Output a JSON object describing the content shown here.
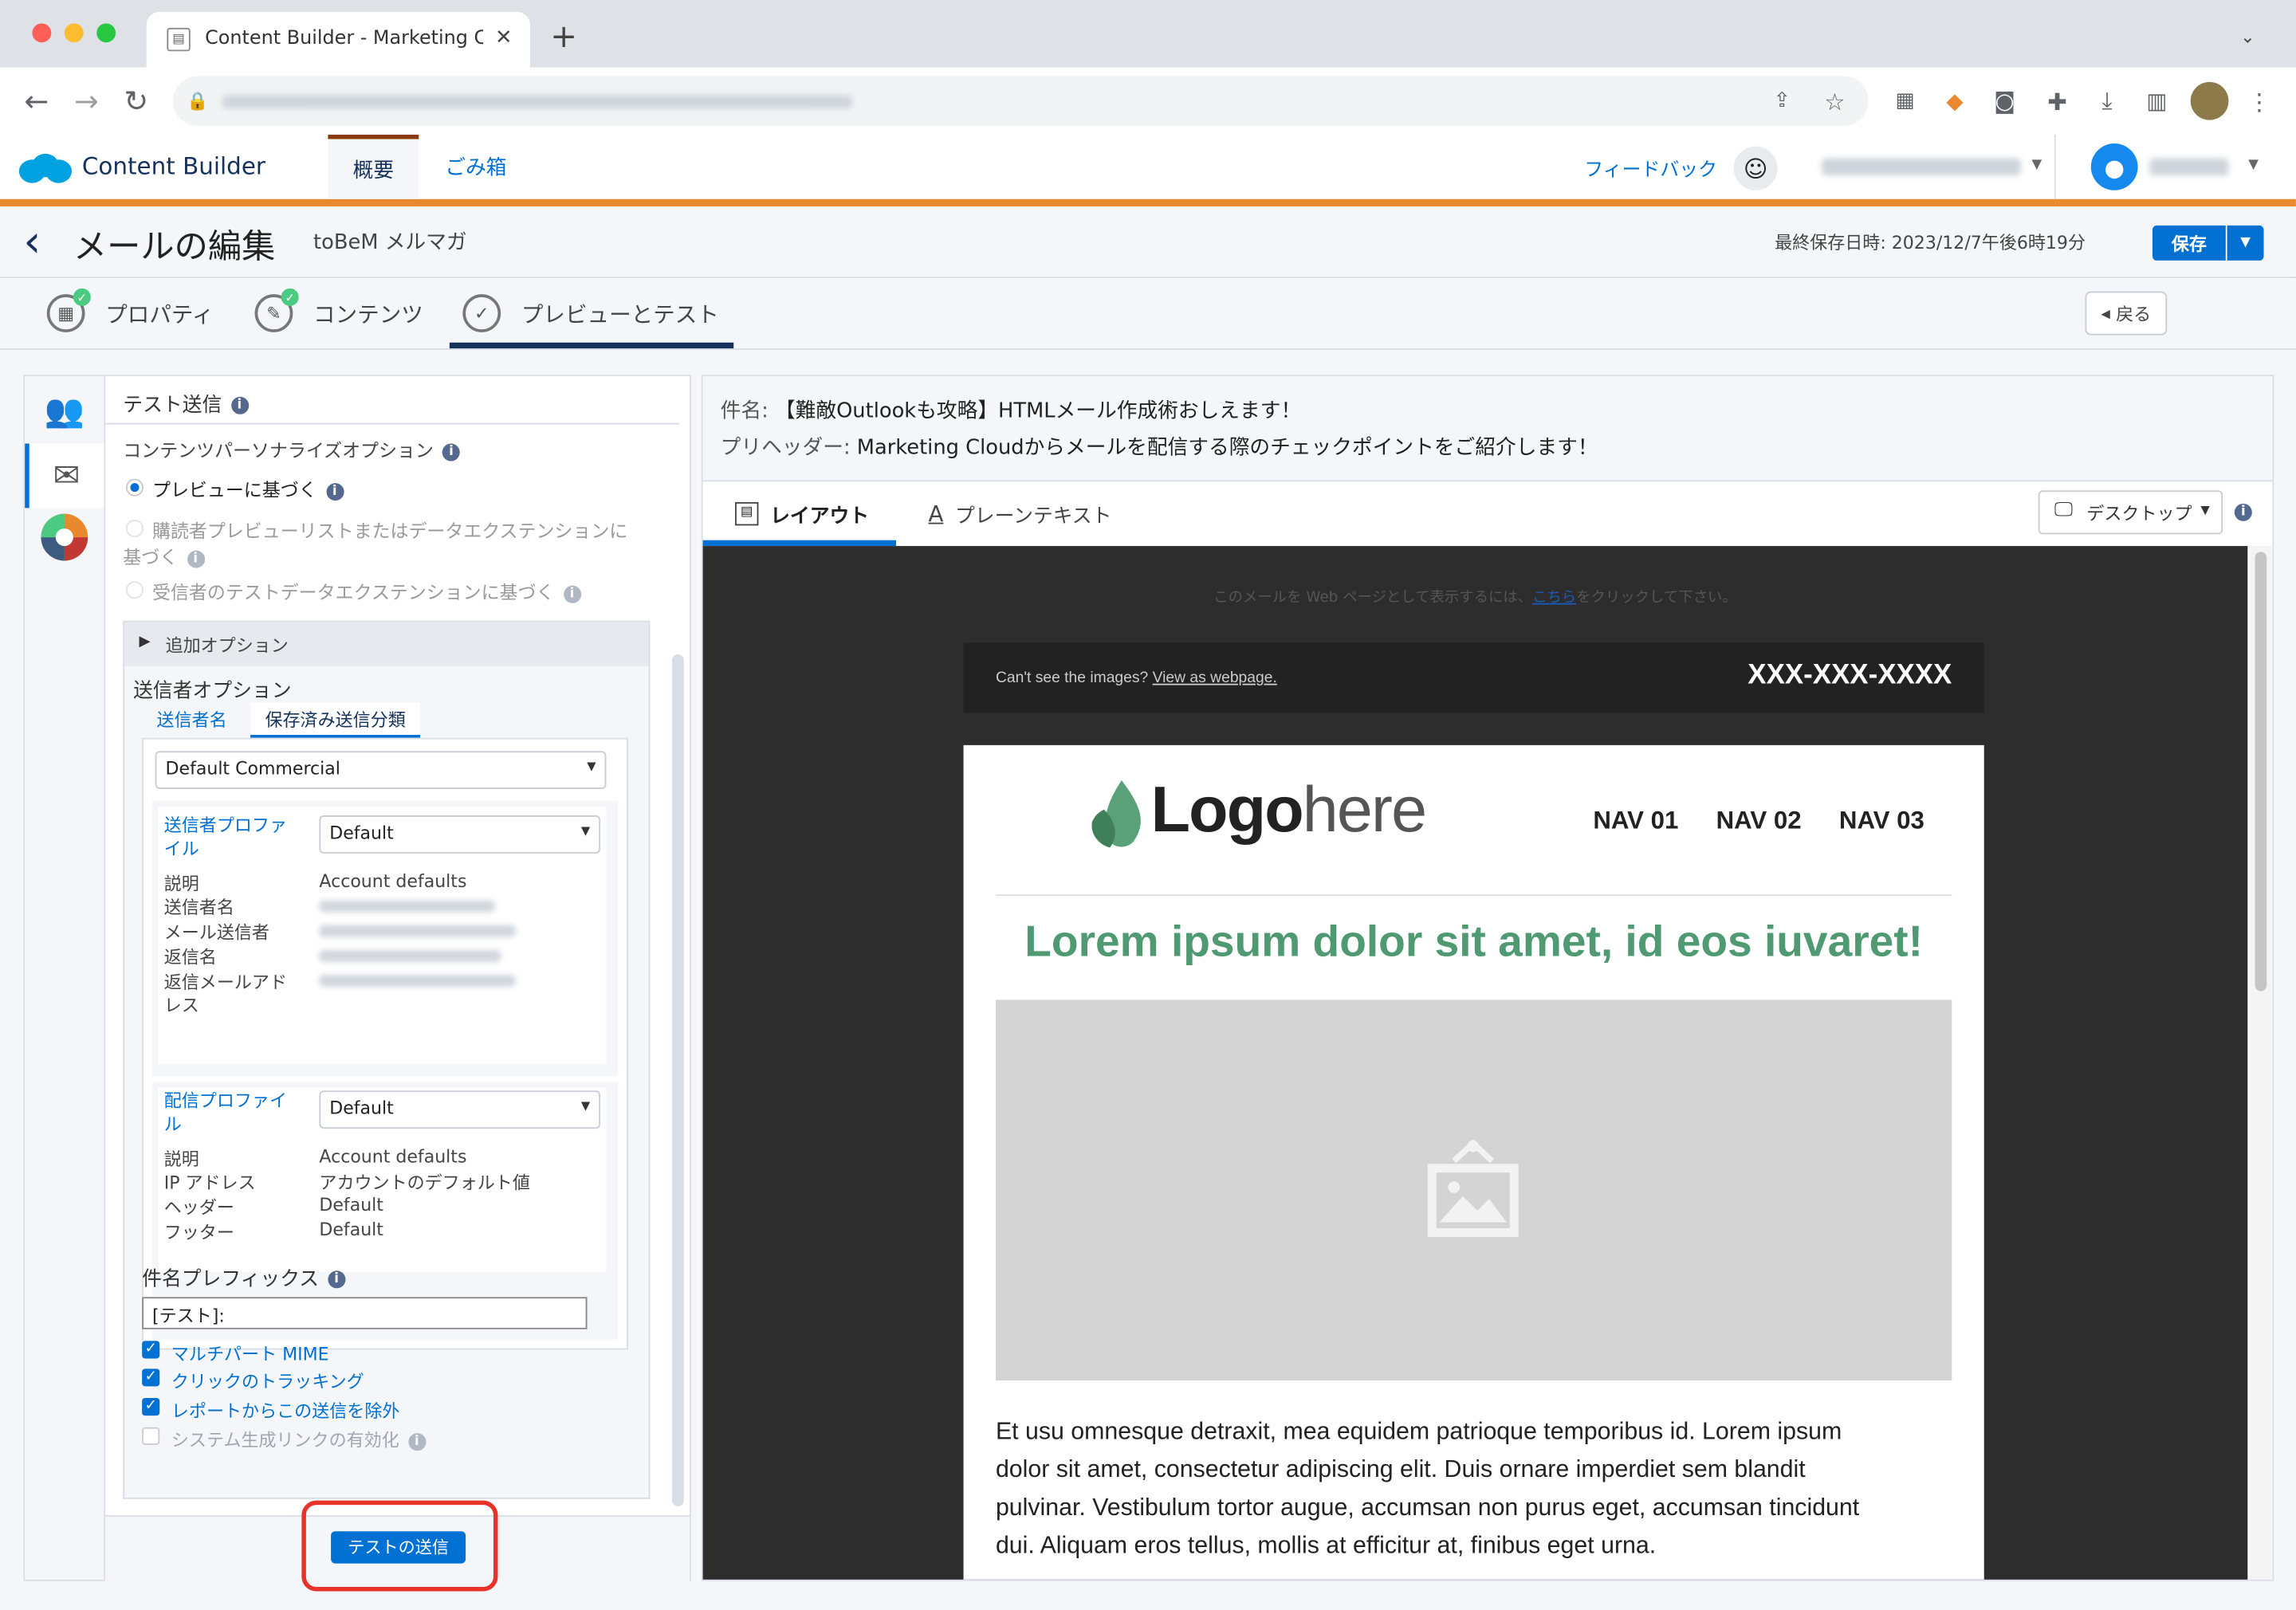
{
  "browser": {
    "tab_title": "Content Builder - Marketing Cl",
    "new_tab_icon": "plus-icon"
  },
  "app": {
    "brand": "Content Builder",
    "tabs": [
      {
        "label": "概要"
      },
      {
        "label": "ごみ箱"
      }
    ],
    "feedback": "フィードバック"
  },
  "edit": {
    "title": "メールの編集",
    "subtitle": "toBeM メルマガ",
    "last_saved": "最終保存日時: 2023/12/7午後6時19分",
    "save_label": "保存",
    "back_label": "戻る"
  },
  "steps": [
    {
      "label": "プロパティ"
    },
    {
      "label": "コンテンツ"
    },
    {
      "label": "プレビューとテスト"
    }
  ],
  "left": {
    "section_title": "テスト送信",
    "personalize_label": "コンテンツパーソナライズオプション",
    "radio1": "プレビューに基づく",
    "radio2_line1": "購読者プレビューリストまたはデータエクステンションに",
    "radio2_line2": "基づく",
    "radio3": "受信者のテストデータエクステンションに基づく",
    "additional_options": "追加オプション",
    "sender_options": "送信者オプション",
    "sender_tabs": [
      "送信者名",
      "保存済み送信分類"
    ],
    "classification_value": "Default Commercial",
    "sender_profile_label_1": "送信者プロファ",
    "sender_profile_label_2": "イル",
    "sender_profile_value": "Default",
    "sender_profile_rows": {
      "desc_key": "説明",
      "desc_val": "Account defaults",
      "from_name_key": "送信者名",
      "from_email_key": "メール送信者",
      "reply_name_key": "返信名",
      "reply_email_key_1": "返信メールアド",
      "reply_email_key_2": "レス"
    },
    "delivery_profile_label_1": "配信プロファイ",
    "delivery_profile_label_2": "ル",
    "delivery_profile_value": "Default",
    "delivery_rows": {
      "desc_key": "説明",
      "desc_val": "Account defaults",
      "ip_key": "IP アドレス",
      "ip_val": "アカウントのデフォルト値",
      "header_key": "ヘッダー",
      "header_val": "Default",
      "footer_key": "フッター",
      "footer_val": "Default"
    },
    "subject_prefix_label": "件名プレフィックス",
    "subject_prefix_value": "[テスト]:",
    "checkboxes": [
      {
        "label": "マルチパート MIME",
        "checked": true
      },
      {
        "label": "クリックのトラッキング",
        "checked": true
      },
      {
        "label": "レポートからこの送信を除外",
        "checked": true
      },
      {
        "label": "システム生成リンクの有効化",
        "checked": false
      }
    ],
    "send_button": "テストの送信"
  },
  "right": {
    "subject_key": "件名:",
    "subject_val": "【難敵Outlookも攻略】HTMLメール作成術おしえます！",
    "preheader_key": "プリヘッダー:",
    "preheader_val": "Marketing Cloudからメールを配信する際のチェックポイントをご紹介します！",
    "tabs": [
      "レイアウト",
      "プレーンテキスト"
    ],
    "device": "デスクトップ"
  },
  "email": {
    "view_web_text": "このメールを Web ページとして表示するには、",
    "view_web_link": "こちら",
    "view_web_suffix": "をクリックして下さい。",
    "cant_see": "Can't see the images?",
    "view_as_webpage": "View as webpage.",
    "phone": "XXX-XXX-XXXX",
    "logo_bold": "Logo",
    "logo_light": "here",
    "nav": [
      "NAV 01",
      "NAV 02",
      "NAV 03"
    ],
    "headline": "Lorem ipsum dolor sit amet, id eos iuvaret!",
    "body_lines": [
      "Et usu omnesque detraxit, mea equidem patrioque temporibus id. Lorem ipsum",
      "dolor sit amet, consectetur adipiscing elit. Duis ornare imperdiet sem blandit",
      "pulvinar. Vestibulum tortor augue, accumsan non purus eget, accumsan tincidunt",
      "dui. Aliquam eros tellus, mollis at efficitur at, finibus eget urna."
    ]
  },
  "colors": {
    "accent_orange": "#e8892f",
    "primary_blue": "#0070d2",
    "headline_green": "#4f9a72",
    "highlight_red": "#e8332a"
  }
}
